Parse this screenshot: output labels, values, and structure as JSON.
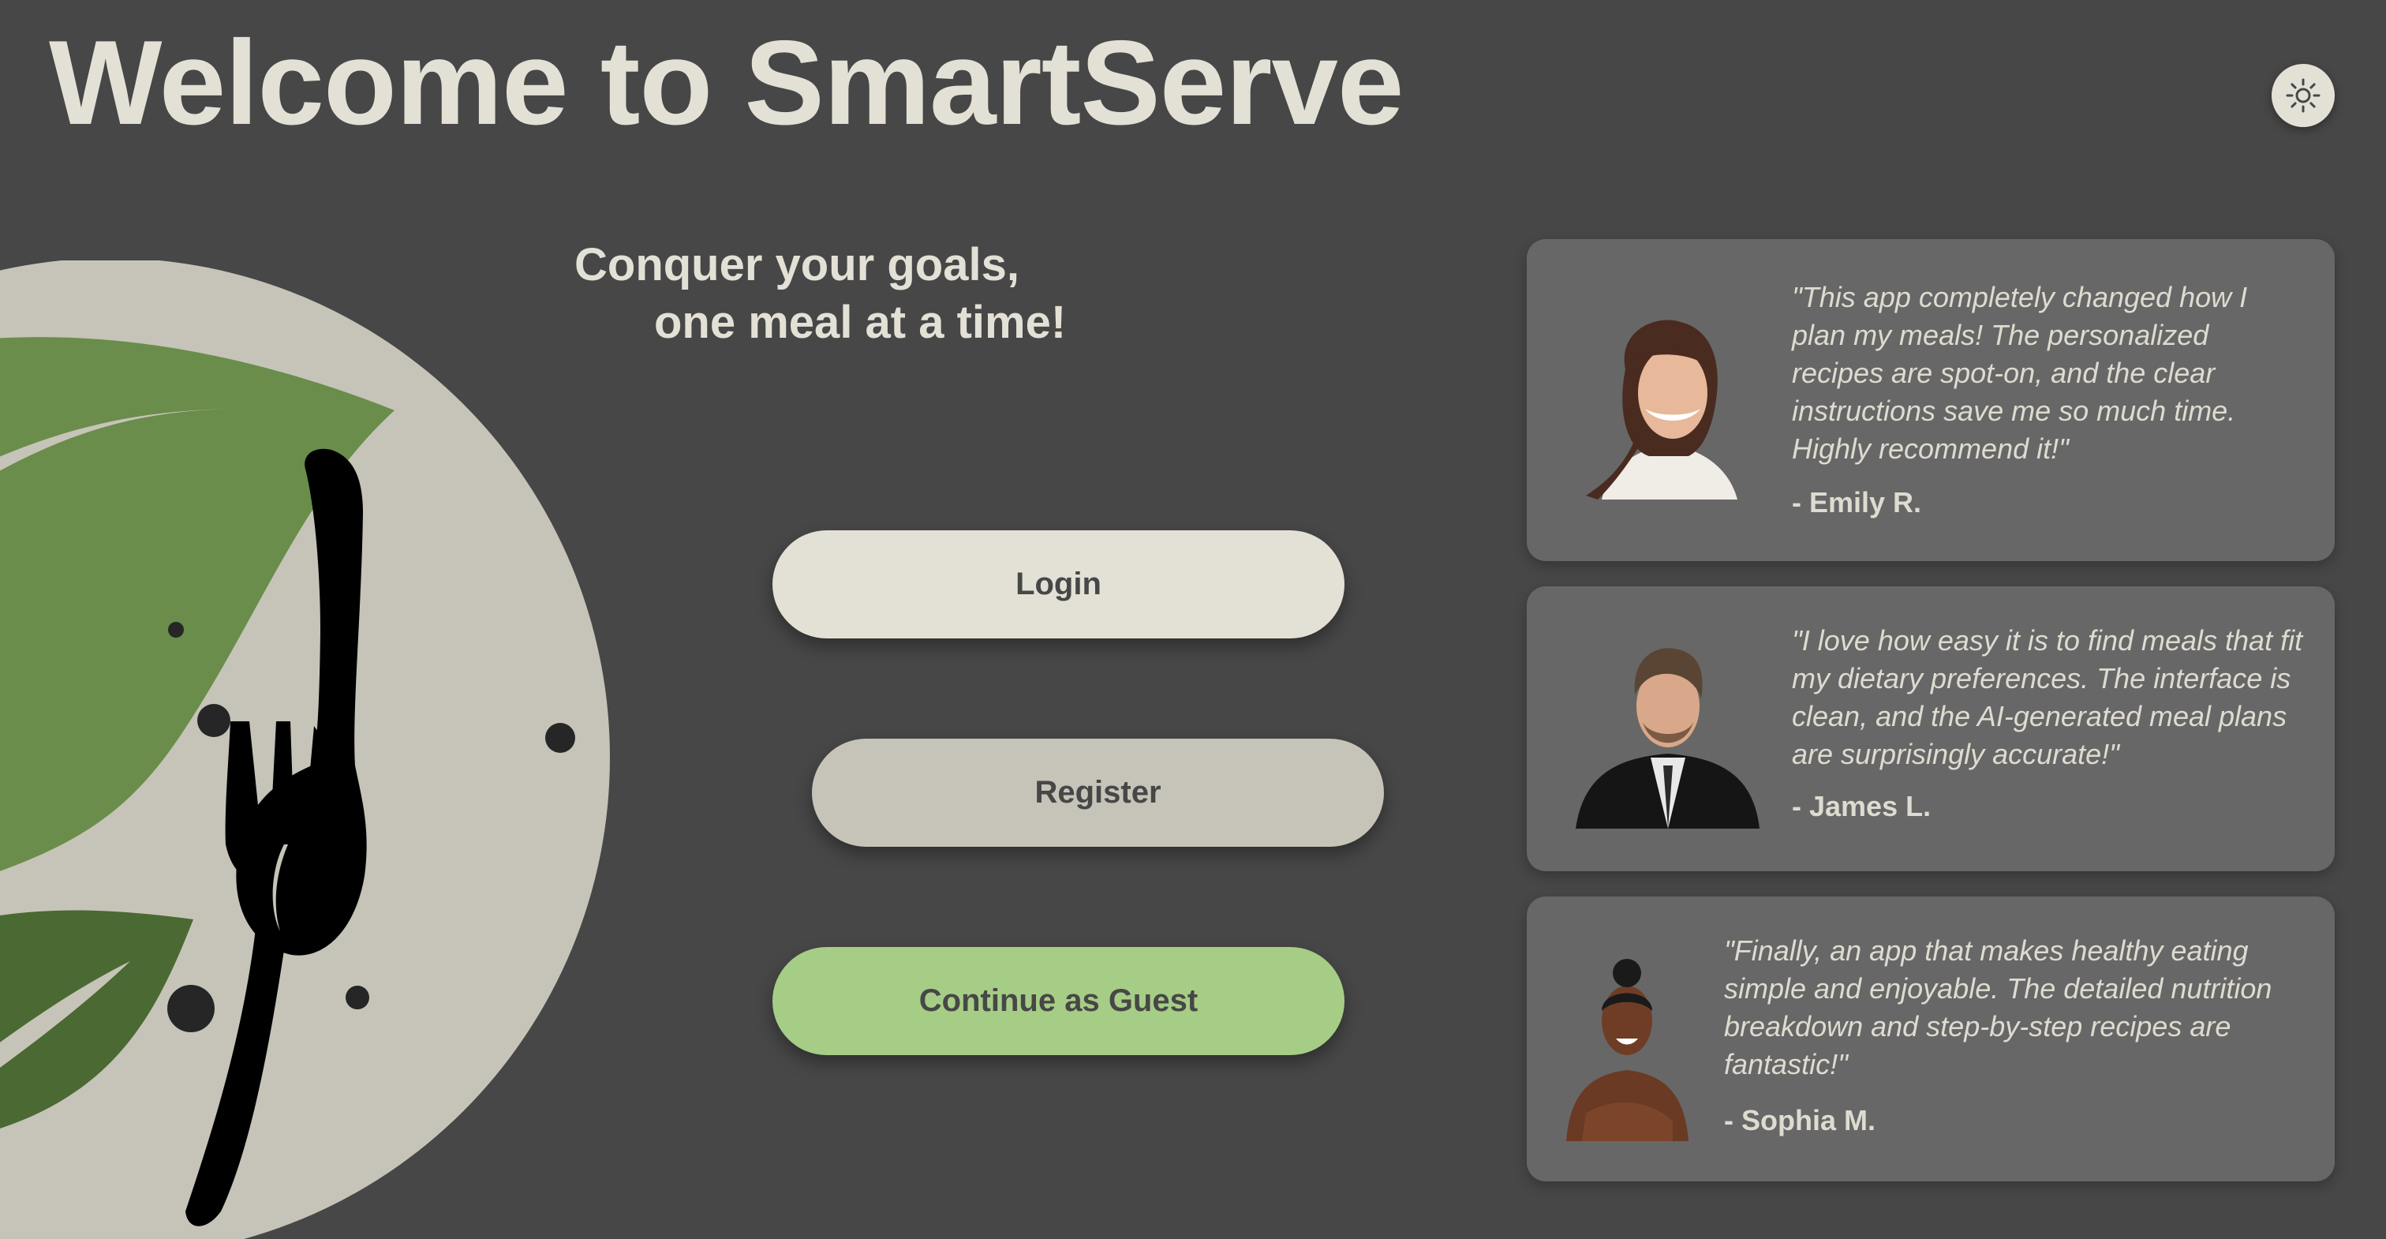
{
  "header": {
    "title": "Welcome to SmartServe",
    "theme_icon": "sun-icon"
  },
  "hero": {
    "tagline_line1": "Conquer your goals,",
    "tagline_line2": "one meal at a time!",
    "logo_icon": "plate-fork-spoon-leaf-logo"
  },
  "actions": {
    "login_label": "Login",
    "register_label": "Register",
    "guest_label": "Continue as Guest"
  },
  "testimonials": [
    {
      "quote": "\"This app completely changed how I plan my meals! The personalized recipes are spot-on, and the clear instructions save me so much time. Highly recommend it!\"",
      "author": "- Emily R."
    },
    {
      "quote": "\"I love how easy it is to find meals that fit my dietary preferences. The interface is clean, and the AI-generated meal plans are surprisingly accurate!\"",
      "author": "- James L."
    },
    {
      "quote": "\"Finally, an app that makes healthy eating simple and enjoyable. The detailed nutrition breakdown and step-by-step recipes are fantastic!\"",
      "author": "- Sophia M."
    }
  ],
  "colors": {
    "background": "#474747",
    "title_text": "#e3e1d6",
    "login_button": "#e3e1d6",
    "register_button": "#c6c4b8",
    "guest_button": "#a6cd85",
    "card_background": "#676767",
    "leaf_green": "#6a8d4b"
  }
}
